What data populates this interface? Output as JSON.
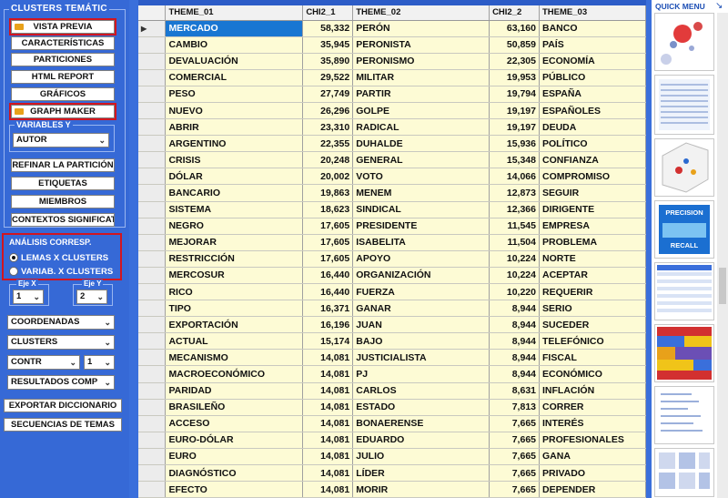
{
  "left_panel": {
    "title": "CLUSTERS TEMÁTIC",
    "buttons": {
      "vista_previa": "VISTA PREVIA",
      "caracteristicas": "CARACTERÍSTICAS",
      "particiones": "PARTICIONES",
      "html_report": "HTML REPORT",
      "graficos": "GRÁFICOS",
      "graph_maker": "GRAPH MAKER",
      "refinar": "REFINAR LA PARTICIÓN",
      "etiquetas": "ETIQUETAS",
      "miembros": "MIEMBROS",
      "contextos": "CONTEXTOS SIGNIFICAT.",
      "exportar": "EXPORTAR DICCIONARIO",
      "secuencias": "SECUENCIAS DE TEMAS"
    },
    "variables_label": "VARIABLES Y",
    "variables_value": "AUTOR",
    "analisis": {
      "title": "ANÁLISIS CORRESP.",
      "option1": "LEMAS X CLUSTERS",
      "option2": "VARIAB. X CLUSTERS",
      "eje_x_label": "Eje X",
      "eje_y_label": "Eje Y",
      "eje_x_value": "1",
      "eje_y_value": "2"
    },
    "dropdowns": {
      "coordenadas": "COORDENADAS",
      "clusters": "CLUSTERS",
      "contr": "CONTR",
      "contr_num": "1",
      "resultados": "RESULTADOS COMP"
    }
  },
  "table": {
    "headers": [
      "THEME_01",
      "CHI2_1",
      "THEME_02",
      "CHI2_2",
      "THEME_03"
    ],
    "rows": [
      [
        "MERCADO",
        "58,332",
        "PERÓN",
        "63,160",
        "BANCO"
      ],
      [
        "CAMBIO",
        "35,945",
        "PERONISTA",
        "50,859",
        "PAÍS"
      ],
      [
        "DEVALUACIÓN",
        "35,890",
        "PERONISMO",
        "22,305",
        "ECONOMÍA"
      ],
      [
        "COMERCIAL",
        "29,522",
        "MILITAR",
        "19,953",
        "PÚBLICO"
      ],
      [
        "PESO",
        "27,749",
        "PARTIR",
        "19,794",
        "ESPAÑA"
      ],
      [
        "NUEVO",
        "26,296",
        "GOLPE",
        "19,197",
        "ESPAÑOLES"
      ],
      [
        "ABRIR",
        "23,310",
        "RADICAL",
        "19,197",
        "DEUDA"
      ],
      [
        "ARGENTINO",
        "22,355",
        "DUHALDE",
        "15,936",
        "POLÍTICO"
      ],
      [
        "CRISIS",
        "20,248",
        "GENERAL",
        "15,348",
        "CONFIANZA"
      ],
      [
        "DÓLAR",
        "20,002",
        "VOTO",
        "14,066",
        "COMPROMISO"
      ],
      [
        "BANCARIO",
        "19,863",
        "MENEM",
        "12,873",
        "SEGUIR"
      ],
      [
        "SISTEMA",
        "18,623",
        "SINDICAL",
        "12,366",
        "DIRIGENTE"
      ],
      [
        "NEGRO",
        "17,605",
        "PRESIDENTE",
        "11,545",
        "EMPRESA"
      ],
      [
        "MEJORAR",
        "17,605",
        "ISABELITA",
        "11,504",
        "PROBLEMA"
      ],
      [
        "RESTRICCIÓN",
        "17,605",
        "APOYO",
        "10,224",
        "NORTE"
      ],
      [
        "MERCOSUR",
        "16,440",
        "ORGANIZACIÓN",
        "10,224",
        "ACEPTAR"
      ],
      [
        "RICO",
        "16,440",
        "FUERZA",
        "10,220",
        "REQUERIR"
      ],
      [
        "TIPO",
        "16,371",
        "GANAR",
        "8,944",
        "SERIO"
      ],
      [
        "EXPORTACIÓN",
        "16,196",
        "JUAN",
        "8,944",
        "SUCEDER"
      ],
      [
        "ACTUAL",
        "15,174",
        "BAJO",
        "8,944",
        "TELEFÓNICO"
      ],
      [
        "MECANISMO",
        "14,081",
        "JUSTICIALISTA",
        "8,944",
        "FISCAL"
      ],
      [
        "MACROECONÓMICO",
        "14,081",
        "PJ",
        "8,944",
        "ECONÓMICO"
      ],
      [
        "PARIDAD",
        "14,081",
        "CARLOS",
        "8,631",
        "INFLACIÓN"
      ],
      [
        "BRASILEÑO",
        "14,081",
        "ESTADO",
        "7,813",
        "CORRER"
      ],
      [
        "ACCESO",
        "14,081",
        "BONAERENSE",
        "7,665",
        "INTERÉS"
      ],
      [
        "EURO-DÓLAR",
        "14,081",
        "EDUARDO",
        "7,665",
        "PROFESIONALES"
      ],
      [
        "EURO",
        "14,081",
        "JULIO",
        "7,665",
        "GANA"
      ],
      [
        "DIAGNÓSTICO",
        "14,081",
        "LÍDER",
        "7,665",
        "PRIVADO"
      ],
      [
        "EFECTO",
        "14,081",
        "MORIR",
        "7,665",
        "DEPENDER"
      ]
    ]
  },
  "quick_menu": {
    "title": "QUICK MENU",
    "precision": "PRECISION",
    "recall": "RECALL"
  }
}
